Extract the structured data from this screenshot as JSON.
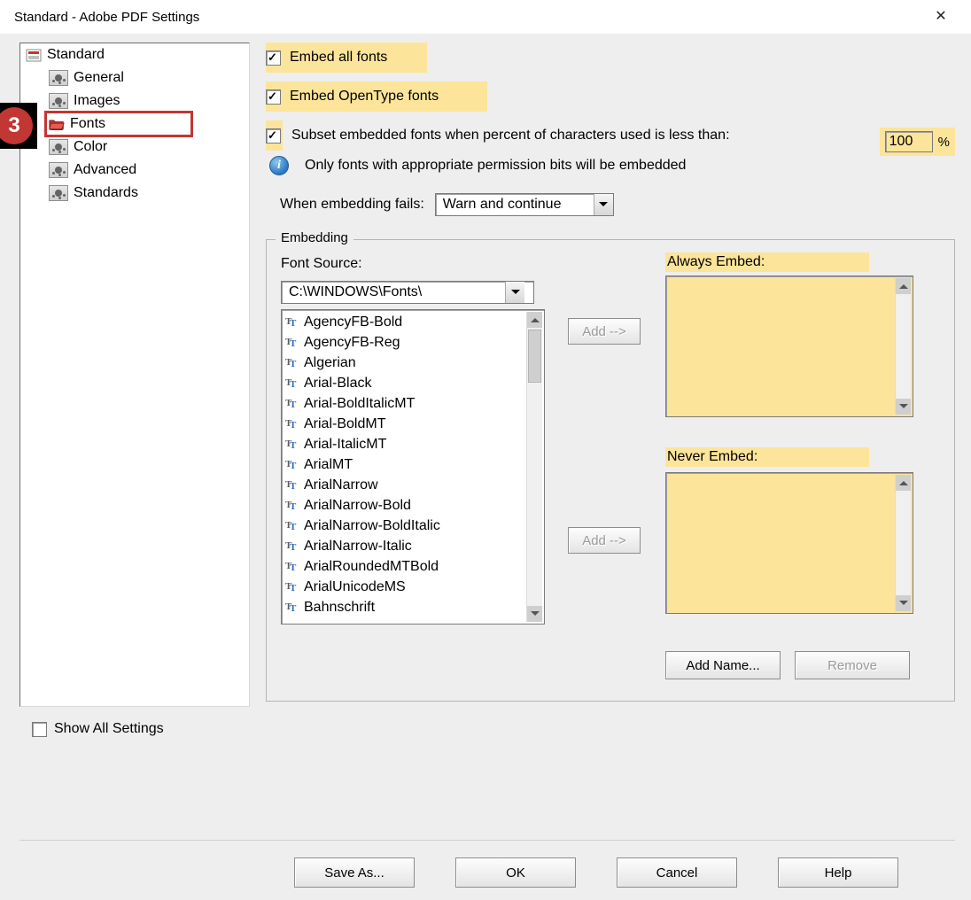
{
  "title": "Standard - Adobe PDF Settings",
  "annotation_number": "3",
  "tree": {
    "root": "Standard",
    "children": [
      "General",
      "Images",
      "Fonts",
      "Color",
      "Advanced",
      "Standards"
    ]
  },
  "show_all_label": "Show All Settings",
  "checks": {
    "embed_all": "Embed all fonts",
    "embed_opentype": "Embed OpenType fonts",
    "subset": "Subset embedded fonts when percent of characters used is less than:"
  },
  "subset_percent_value": "100",
  "subset_percent_sign": "%",
  "info_text": "Only fonts with appropriate permission bits will be embedded",
  "fails_label": "When embedding fails:",
  "fails_value": "Warn and continue",
  "embedding": {
    "group_title": "Embedding",
    "font_source_label": "Font Source:",
    "font_source_value": "C:\\WINDOWS\\Fonts\\",
    "fonts": [
      "AgencyFB-Bold",
      "AgencyFB-Reg",
      "Algerian",
      "Arial-Black",
      "Arial-BoldItalicMT",
      "Arial-BoldMT",
      "Arial-ItalicMT",
      "ArialMT",
      "ArialNarrow",
      "ArialNarrow-Bold",
      "ArialNarrow-BoldItalic",
      "ArialNarrow-Italic",
      "ArialRoundedMTBold",
      "ArialUnicodeMS",
      "Bahnschrift"
    ],
    "always_label": "Always Embed:",
    "never_label": "Never Embed:",
    "add_label": "Add -->",
    "add_name_label": "Add Name...",
    "remove_label": "Remove"
  },
  "buttons": {
    "save_as": "Save As...",
    "ok": "OK",
    "cancel": "Cancel",
    "help": "Help"
  }
}
